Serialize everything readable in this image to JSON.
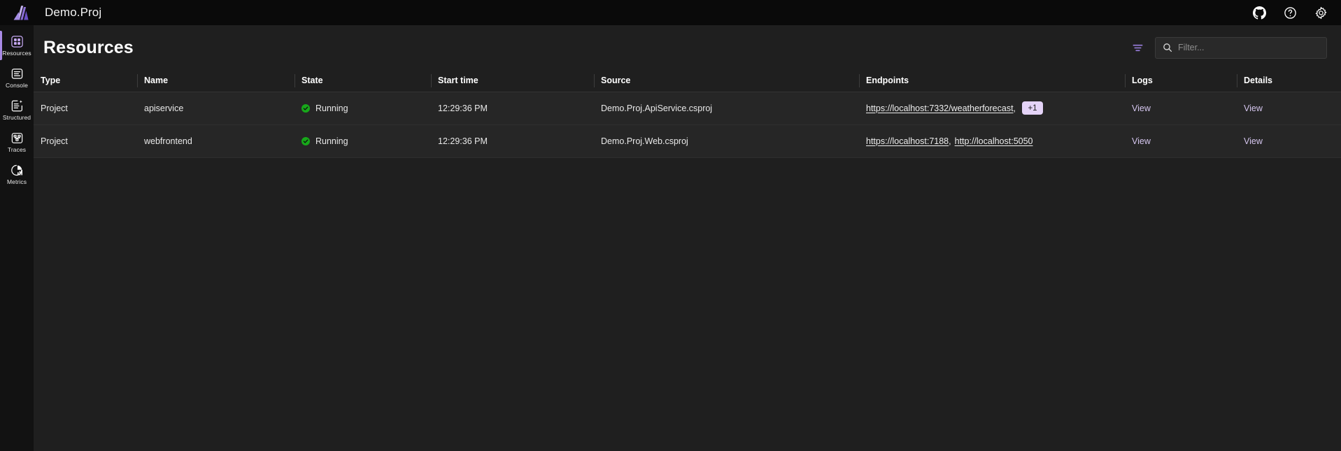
{
  "topbar": {
    "app_title": "Demo.Proj",
    "logo_name": "aspire-logo",
    "actions": [
      {
        "name": "github-icon",
        "label": "GitHub"
      },
      {
        "name": "help-icon",
        "label": "Help"
      },
      {
        "name": "settings-gear-icon",
        "label": "Settings"
      }
    ]
  },
  "sidebar": {
    "items": [
      {
        "label": "Resources",
        "icon": "resources-grid-icon",
        "active": true
      },
      {
        "label": "Console",
        "icon": "console-logs-icon",
        "active": false
      },
      {
        "label": "Structured",
        "icon": "structured-logs-icon",
        "active": false
      },
      {
        "label": "Traces",
        "icon": "traces-icon",
        "active": false
      },
      {
        "label": "Metrics",
        "icon": "metrics-chart-icon",
        "active": false
      }
    ]
  },
  "page": {
    "title": "Resources",
    "filter_icon": "filter-icon",
    "search": {
      "icon": "search-icon",
      "placeholder": "Filter...",
      "value": ""
    }
  },
  "table": {
    "columns": [
      {
        "key": "type",
        "label": "Type"
      },
      {
        "key": "name",
        "label": "Name"
      },
      {
        "key": "state",
        "label": "State"
      },
      {
        "key": "start_time",
        "label": "Start time"
      },
      {
        "key": "source",
        "label": "Source"
      },
      {
        "key": "endpoints",
        "label": "Endpoints"
      },
      {
        "key": "logs",
        "label": "Logs"
      },
      {
        "key": "details",
        "label": "Details"
      }
    ],
    "rows": [
      {
        "type": "Project",
        "name": "apiservice",
        "state": "Running",
        "state_color": "#17a81a",
        "start_time": "12:29:36 PM",
        "source": "Demo.Proj.ApiService.csproj",
        "endpoints": [
          {
            "text": "https://localhost:7332/weatherforecast"
          }
        ],
        "endpoints_more": "+1",
        "logs_label": "View",
        "details_label": "View"
      },
      {
        "type": "Project",
        "name": "webfrontend",
        "state": "Running",
        "state_color": "#17a81a",
        "start_time": "12:29:36 PM",
        "source": "Demo.Proj.Web.csproj",
        "endpoints": [
          {
            "text": "https://localhost:7188"
          },
          {
            "text": "http://localhost:5050"
          }
        ],
        "endpoints_more": "",
        "logs_label": "View",
        "details_label": "View"
      }
    ]
  },
  "colors": {
    "accent_purple": "#a98ae6",
    "badge_bg": "#e4d3f7",
    "running_green": "#17a81a",
    "topbar_bg": "#0a0a0a",
    "sidebar_bg": "#121212",
    "main_bg": "#1f1f1f",
    "row_bg": "#262626"
  }
}
